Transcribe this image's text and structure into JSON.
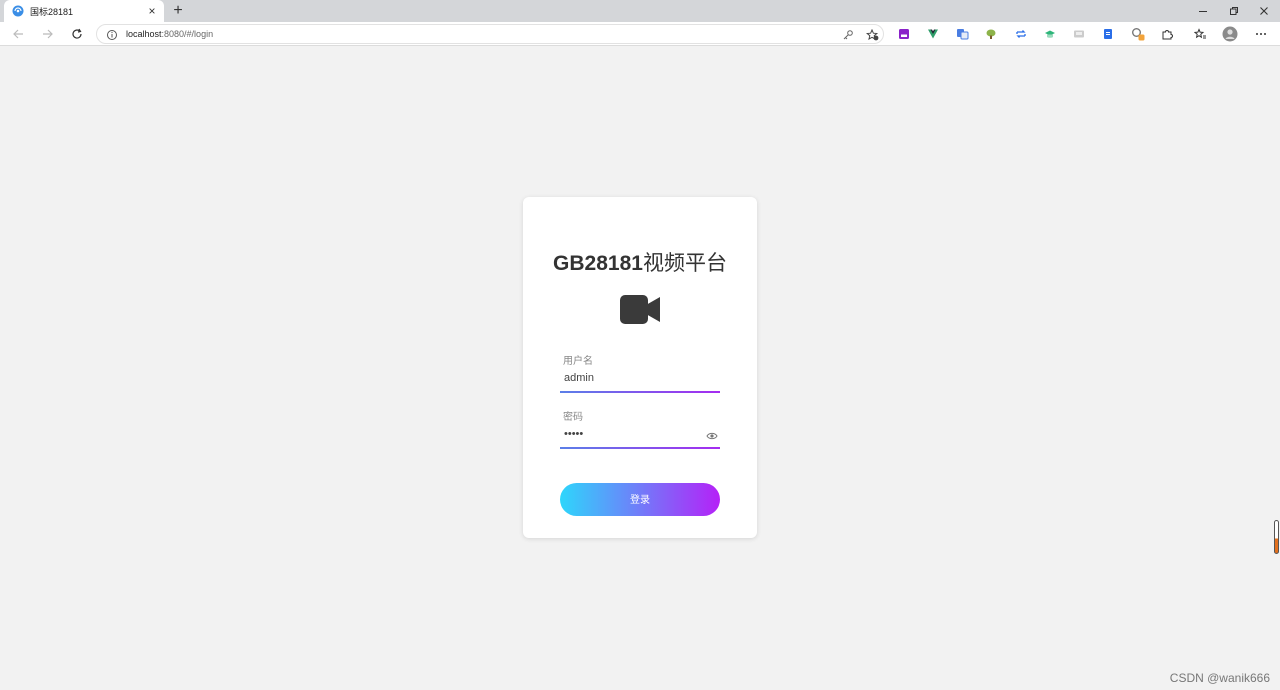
{
  "browser": {
    "tab": {
      "title": "国标28181",
      "favicon": "globe-icon",
      "close": "×"
    },
    "new_tab": "+",
    "address": {
      "host": "localhost",
      "rest": ":8080/#/login"
    },
    "toolbar_icons": [
      "back-icon",
      "forward-icon",
      "refresh-icon",
      "info-icon",
      "key-icon",
      "star-add-icon"
    ],
    "extensions": [
      "ext-purple",
      "ext-vue",
      "ext-translate",
      "ext-tree",
      "ext-sync",
      "ext-graduate",
      "ext-gray",
      "ext-doc",
      "ext-search",
      "puzzle-icon",
      "favorites-icon",
      "profile-icon",
      "more-icon"
    ]
  },
  "login": {
    "title_bold": "GB28181",
    "title_rest": "视频平台",
    "logo_icon": "video-camera-icon",
    "username_label": "用户名",
    "username_value": "admin",
    "password_label": "密码",
    "password_value": "•••••",
    "button_label": "登录",
    "colors": {
      "gradient_start": "#2ed6fb",
      "gradient_end": "#b521f7"
    }
  },
  "watermark": "CSDN @wanik666"
}
